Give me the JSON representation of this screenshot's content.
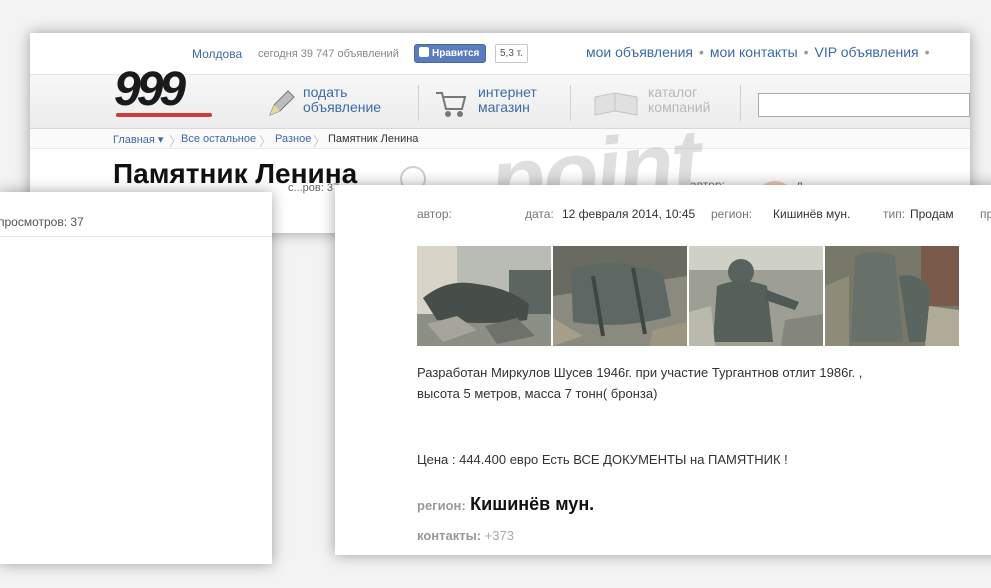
{
  "topbar": {
    "region": "Молдова",
    "ads_count": "сегодня 39 747 объявлений",
    "like_label": "Нравится",
    "like_count": "5,3 т.",
    "links": [
      "мои объявления",
      "мои контакты",
      "VIP объявления"
    ],
    "separator": "•"
  },
  "logo": {
    "text": "999"
  },
  "nav": {
    "post_ad": {
      "line1": "подать",
      "line2": "объявление"
    },
    "shop": {
      "line1": "интернет",
      "line2": "магазин"
    },
    "catalog": {
      "line1": "каталог",
      "line2": "компаний"
    }
  },
  "breadcrumb": [
    "Главная ▾",
    "Все остальное",
    "Разное",
    "Памятник Ленина"
  ],
  "page": {
    "title": "Памятник Ленина",
    "views_partial": "с...ров: 37",
    "author_partial": "автор:",
    "date_partial": "д..."
  },
  "watermark": {
    "text": "point"
  },
  "left_card": {
    "views": "просмотров: 37"
  },
  "ad": {
    "author_label": "автор:",
    "date_label": "дата:",
    "date_value": "12 февраля 2014, 10:45",
    "region_label": "регион:",
    "region_value": "Кишинёв мун.",
    "type_label": "тип:",
    "type_value": "Продам",
    "more_label": "пр",
    "description_line1": "Разработан Миркулов Шусев 1946г. при участие Тургантнов отлит 1986г. ,",
    "description_line2": "высота 5 метров, масса 7 тонн( бронза)",
    "price_text": "Цена : 444.400 евро Есть ВСЕ ДОКУМЕНТЫ на ПАМЯТНИК !",
    "region_big_label": "регион:",
    "region_big_value": "Кишинёв мун.",
    "contacts_label": "контакты:",
    "contacts_value": "+373"
  },
  "colors": {
    "link": "#3b6aa8",
    "logo_underline": "#d23a3a",
    "like_button": "#5b7bbf"
  },
  "icons": {
    "post_ad": "pencil-icon",
    "shop": "cart-icon",
    "catalog": "book-icon",
    "like": "thumbs-up-icon"
  }
}
